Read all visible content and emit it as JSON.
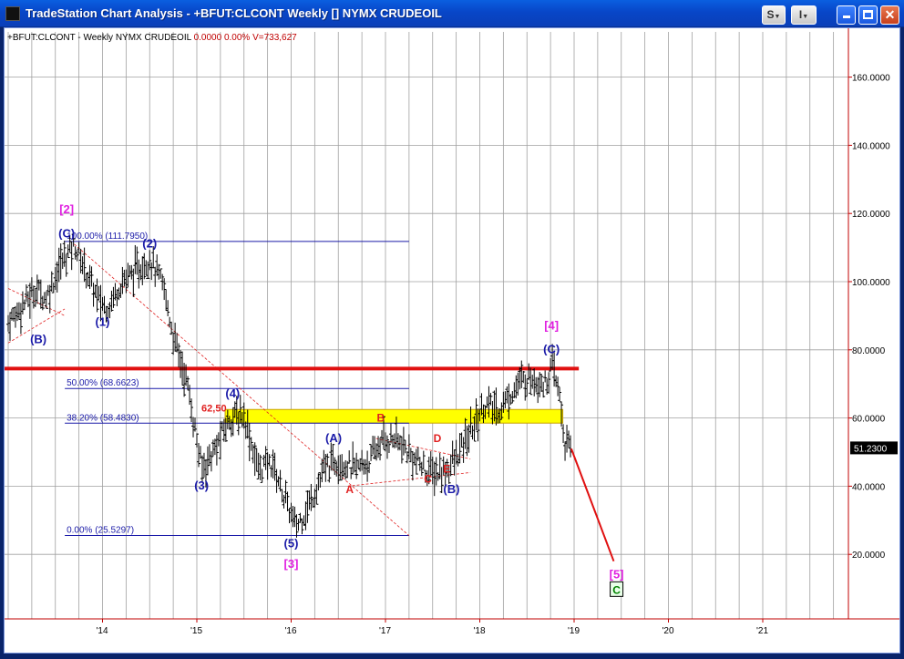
{
  "window": {
    "title": "TradeStation Chart Analysis - +BFUT:CLCONT Weekly [] NYMX CRUDEOIL",
    "buttons": {
      "s": "S",
      "i": "I"
    }
  },
  "chart_header": {
    "symbol": "+BFUT:CLCONT - Weekly  NYMX CRUDEOIL",
    "change": "0.0000",
    "change_pct": "0.00%",
    "volume": "V=733,627"
  },
  "colors": {
    "bar": "#000000",
    "wave_blue": "#1a1aa8",
    "wave_magenta": "#e020e0",
    "sub_red": "#e02020",
    "fib_line": "#1a1aa8",
    "resistance": "#e01010",
    "zone_fill": "#ffff00",
    "grid": "#a0a0a0",
    "axis": "#c00000"
  },
  "chart_data": {
    "type": "ohlc",
    "symbol": "+BFUT:CLCONT",
    "interval": "Weekly",
    "x_ticks": [
      "'14",
      "'15",
      "'16",
      "'17",
      "'18",
      "'19",
      "'20",
      "'21"
    ],
    "y_ticks": [
      "20.0000",
      "40.0000",
      "60.0000",
      "80.0000",
      "100.0000",
      "120.0000",
      "140.0000",
      "160.0000"
    ],
    "ylim": [
      0,
      170
    ],
    "last_price": "51.2300",
    "price_path": [
      [
        2013.0,
        88
      ],
      [
        2013.3,
        98
      ],
      [
        2013.4,
        95
      ],
      [
        2013.55,
        105
      ],
      [
        2013.7,
        111
      ],
      [
        2013.95,
        95
      ],
      [
        2014.05,
        92
      ],
      [
        2014.2,
        100
      ],
      [
        2014.35,
        103
      ],
      [
        2014.5,
        107
      ],
      [
        2014.65,
        98
      ],
      [
        2014.75,
        84
      ],
      [
        2014.9,
        70
      ],
      [
        2015.05,
        45
      ],
      [
        2015.2,
        51
      ],
      [
        2015.35,
        60
      ],
      [
        2015.5,
        61
      ],
      [
        2015.65,
        45
      ],
      [
        2015.8,
        47
      ],
      [
        2015.95,
        35
      ],
      [
        2016.05,
        28
      ],
      [
        2016.2,
        35
      ],
      [
        2016.35,
        45
      ],
      [
        2016.5,
        48
      ],
      [
        2016.6,
        46
      ],
      [
        2016.7,
        45
      ],
      [
        2016.85,
        48
      ],
      [
        2016.95,
        53
      ],
      [
        2017.1,
        54
      ],
      [
        2017.3,
        48
      ],
      [
        2017.45,
        44
      ],
      [
        2017.6,
        44
      ],
      [
        2017.75,
        48
      ],
      [
        2017.9,
        56
      ],
      [
        2018.05,
        64
      ],
      [
        2018.2,
        62
      ],
      [
        2018.4,
        70
      ],
      [
        2018.55,
        72
      ],
      [
        2018.7,
        70
      ],
      [
        2018.77,
        75
      ],
      [
        2018.85,
        66
      ],
      [
        2018.9,
        52
      ],
      [
        2018.97,
        51
      ]
    ],
    "fib_levels": [
      {
        "label": "100.00% (111.7950)",
        "value": 111.795
      },
      {
        "label": "50.00% (68.6623)",
        "value": 68.6623
      },
      {
        "label": "38.20% (58.4830)",
        "value": 58.483
      },
      {
        "label": "0.00% (25.5297)",
        "value": 25.5297
      }
    ],
    "zone": {
      "label": "62,50",
      "low": 58.5,
      "high": 62.5
    },
    "resistance": 74.5,
    "projection": {
      "from": [
        2018.97,
        51
      ],
      "to": [
        2019.42,
        18
      ]
    },
    "wave_labels": [
      {
        "text": "[2]",
        "x": 2013.62,
        "y": 120,
        "color": "magenta"
      },
      {
        "text": "(C)",
        "x": 2013.62,
        "y": 113,
        "color": "blue"
      },
      {
        "text": "(2)",
        "x": 2014.5,
        "y": 110,
        "color": "blue"
      },
      {
        "text": "(B)",
        "x": 2013.32,
        "y": 82,
        "color": "blue"
      },
      {
        "text": "(1)",
        "x": 2014.0,
        "y": 87,
        "color": "blue"
      },
      {
        "text": "(4)",
        "x": 2015.38,
        "y": 66,
        "color": "blue"
      },
      {
        "text": "(3)",
        "x": 2015.05,
        "y": 39,
        "color": "blue"
      },
      {
        "text": "(A)",
        "x": 2016.45,
        "y": 53,
        "color": "blue"
      },
      {
        "text": "(5)",
        "x": 2016.0,
        "y": 22,
        "color": "blue"
      },
      {
        "text": "[3]",
        "x": 2016.0,
        "y": 16,
        "color": "magenta"
      },
      {
        "text": "(B)",
        "x": 2017.7,
        "y": 38,
        "color": "blue"
      },
      {
        "text": "[4]",
        "x": 2018.76,
        "y": 86,
        "color": "magenta"
      },
      {
        "text": "(C)",
        "x": 2018.76,
        "y": 79,
        "color": "blue"
      },
      {
        "text": "[5]",
        "x": 2019.45,
        "y": 13,
        "color": "magenta"
      },
      {
        "text": "A",
        "x": 2016.62,
        "y": 38,
        "color": "red"
      },
      {
        "text": "B",
        "x": 2016.95,
        "y": 59,
        "color": "red"
      },
      {
        "text": "C",
        "x": 2017.45,
        "y": 41,
        "color": "red"
      },
      {
        "text": "D",
        "x": 2017.55,
        "y": 53,
        "color": "red"
      },
      {
        "text": "E",
        "x": 2017.65,
        "y": 44,
        "color": "red"
      }
    ],
    "terminal_label": {
      "text": "C",
      "x": 2019.45,
      "y": 9
    }
  }
}
